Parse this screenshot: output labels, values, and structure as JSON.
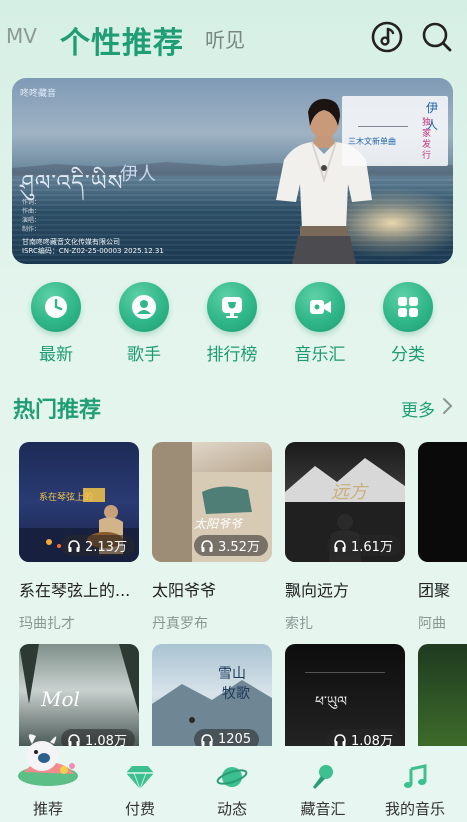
{
  "header": {
    "tabs": [
      "MV",
      "个性推荐",
      "听见"
    ],
    "active_tab": "个性推荐",
    "icons": [
      "music-note-icon",
      "search-icon"
    ]
  },
  "banner": {
    "brand": "咚咚藏音",
    "tibetan_title": "ཤུལ་འདི་ཡིས",
    "title": "伊人",
    "info_lines": [
      "作词：",
      "作曲：",
      "演唱：",
      "制作：",
      "监制："
    ],
    "company": "甘南咚咚藏音文化传媒有限公司",
    "isrc": "ISRC编码：CN-Z02-25-00003 2025.12.31",
    "card_title": "伊人",
    "card_exclusive": "独家发行",
    "card_subtitle": "三木文新单曲",
    "card_tibetan": "ཤུལ་འདི་ཡིས"
  },
  "categories": [
    {
      "label": "最新",
      "icon": "clock-icon"
    },
    {
      "label": "歌手",
      "icon": "singer-icon"
    },
    {
      "label": "排行榜",
      "icon": "trophy-icon"
    },
    {
      "label": "音乐汇",
      "icon": "video-camera-icon"
    },
    {
      "label": "分类",
      "icon": "grid-icon"
    }
  ],
  "section": {
    "title": "热门推荐",
    "more": "更多"
  },
  "albums_row1": [
    {
      "name": "系在琴弦上的...",
      "artist": "玛曲扎才",
      "plays": "2.13万"
    },
    {
      "name": "太阳爷爷",
      "artist": "丹真罗布",
      "plays": "3.52万"
    },
    {
      "name": "飘向远方",
      "artist": "索扎",
      "plays": "1.61万"
    },
    {
      "name": "团聚",
      "artist": "阿曲",
      "plays": ""
    }
  ],
  "albums_row2": [
    {
      "plays": "1.08万"
    },
    {
      "plays": "1205"
    },
    {
      "plays": "1.08万"
    },
    {
      "plays": ""
    }
  ],
  "bottom_nav": [
    {
      "label": "推荐",
      "icon": "mascot-icon"
    },
    {
      "label": "付费",
      "icon": "diamond-icon"
    },
    {
      "label": "动态",
      "icon": "planet-icon"
    },
    {
      "label": "藏音汇",
      "icon": "microphone-icon"
    },
    {
      "label": "我的音乐",
      "icon": "music-note-icon"
    }
  ],
  "colors": {
    "accent": "#1f9e76",
    "background": "#dff2ea"
  }
}
